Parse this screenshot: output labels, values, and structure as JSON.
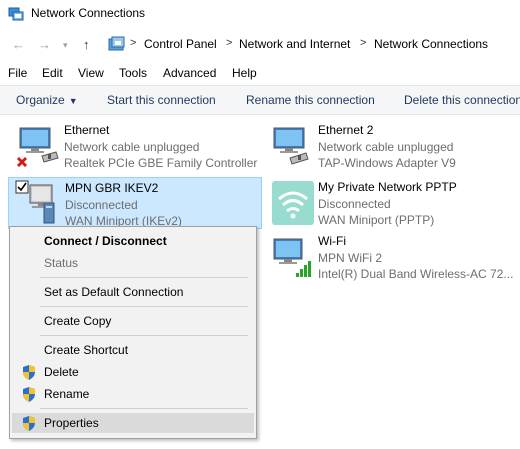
{
  "window": {
    "title": "Network Connections"
  },
  "address": {
    "crumbs": [
      "Control Panel",
      "Network and Internet",
      "Network Connections"
    ]
  },
  "menu": [
    "File",
    "Edit",
    "View",
    "Tools",
    "Advanced",
    "Help"
  ],
  "commands": {
    "organize": "Organize",
    "start": "Start this connection",
    "rename": "Rename this connection",
    "delete": "Delete this connection"
  },
  "connections": [
    {
      "name": "Ethernet",
      "status": "Network cable unplugged",
      "device": "Realtek PCIe GBE Family Controller",
      "icon": "ethernet-unplugged-icon"
    },
    {
      "name": "Ethernet 2",
      "status": "Network cable unplugged",
      "device": "TAP-Windows Adapter V9",
      "icon": "ethernet-icon"
    },
    {
      "name": "MPN GBR IKEV2",
      "status": "Disconnected",
      "device": "WAN Miniport (IKEv2)",
      "icon": "vpn-computer-icon"
    },
    {
      "name": "My Private Network PPTP",
      "status": "Disconnected",
      "device": "WAN Miniport (PPTP)",
      "icon": "wifi-logo-icon"
    },
    {
      "name": "Wi-Fi",
      "status": "MPN WiFi  2",
      "device": "Intel(R) Dual Band Wireless-AC 72...",
      "icon": "wifi-signal-icon"
    }
  ],
  "context_menu": {
    "connect": "Connect / Disconnect",
    "status": "Status",
    "set_default": "Set as Default Connection",
    "create_copy": "Create Copy",
    "create_shortcut": "Create Shortcut",
    "delete": "Delete",
    "rename": "Rename",
    "properties": "Properties"
  },
  "colors": {
    "selection": "#cce8ff",
    "selection_border": "#99d1ff",
    "command_text": "#1e395b"
  }
}
